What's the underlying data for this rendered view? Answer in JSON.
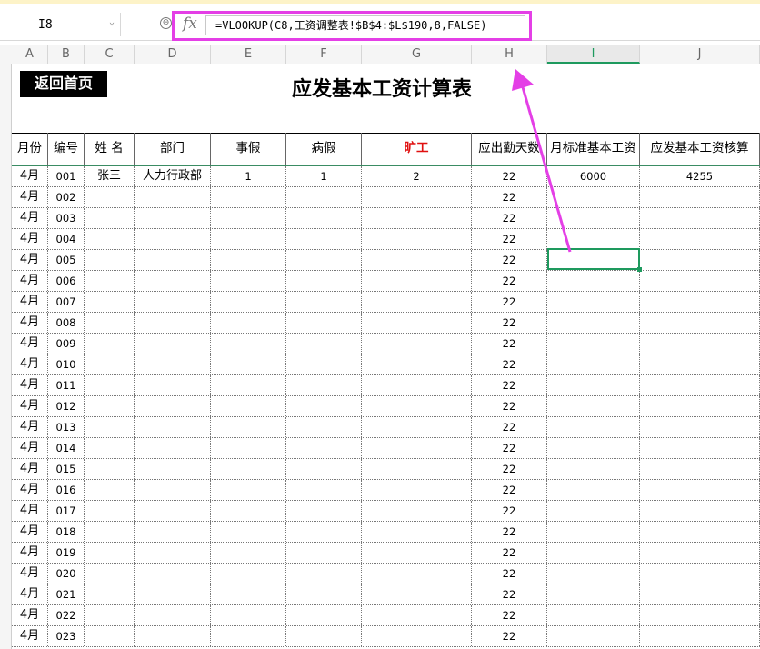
{
  "formula_bar": {
    "cell_ref": "I8",
    "fx_label": "fx",
    "formula": "=VLOOKUP(C8,工资调整表!$B$4:$L$190,8,FALSE)"
  },
  "columns": [
    "A",
    "B",
    "C",
    "D",
    "E",
    "F",
    "G",
    "H",
    "I",
    "J"
  ],
  "active_column": "I",
  "row_numbers": [
    "",
    "",
    "",
    "",
    "",
    "",
    "",
    "",
    "",
    "",
    "",
    "",
    "",
    "",
    "",
    "",
    "",
    "",
    "",
    "",
    "",
    "",
    "",
    "",
    "",
    "",
    "",
    "",
    "",
    ""
  ],
  "sheet": {
    "back_button": "返回首页",
    "title": "应发基本工资计算表",
    "headers": [
      "月份",
      "编号",
      "姓 名",
      "部门",
      "事假",
      "病假",
      "旷工",
      "应出勤天数",
      "月标准基本工资",
      "应发基本工资核算"
    ],
    "rows": [
      {
        "month": "4月",
        "id": "001",
        "name": "张三",
        "dept": "人力行政部",
        "personal_leave": "1",
        "sick_leave": "1",
        "absent": "2",
        "required_days": "22",
        "std_salary": "6000",
        "calc_salary": "4255"
      },
      {
        "month": "4月",
        "id": "002",
        "name": "",
        "dept": "",
        "personal_leave": "",
        "sick_leave": "",
        "absent": "",
        "required_days": "22",
        "std_salary": "",
        "calc_salary": ""
      },
      {
        "month": "4月",
        "id": "003",
        "name": "",
        "dept": "",
        "personal_leave": "",
        "sick_leave": "",
        "absent": "",
        "required_days": "22",
        "std_salary": "",
        "calc_salary": ""
      },
      {
        "month": "4月",
        "id": "004",
        "name": "",
        "dept": "",
        "personal_leave": "",
        "sick_leave": "",
        "absent": "",
        "required_days": "22",
        "std_salary": "",
        "calc_salary": ""
      },
      {
        "month": "4月",
        "id": "005",
        "name": "",
        "dept": "",
        "personal_leave": "",
        "sick_leave": "",
        "absent": "",
        "required_days": "22",
        "std_salary": "",
        "calc_salary": ""
      },
      {
        "month": "4月",
        "id": "006",
        "name": "",
        "dept": "",
        "personal_leave": "",
        "sick_leave": "",
        "absent": "",
        "required_days": "22",
        "std_salary": "",
        "calc_salary": ""
      },
      {
        "month": "4月",
        "id": "007",
        "name": "",
        "dept": "",
        "personal_leave": "",
        "sick_leave": "",
        "absent": "",
        "required_days": "22",
        "std_salary": "",
        "calc_salary": ""
      },
      {
        "month": "4月",
        "id": "008",
        "name": "",
        "dept": "",
        "personal_leave": "",
        "sick_leave": "",
        "absent": "",
        "required_days": "22",
        "std_salary": "",
        "calc_salary": ""
      },
      {
        "month": "4月",
        "id": "009",
        "name": "",
        "dept": "",
        "personal_leave": "",
        "sick_leave": "",
        "absent": "",
        "required_days": "22",
        "std_salary": "",
        "calc_salary": ""
      },
      {
        "month": "4月",
        "id": "010",
        "name": "",
        "dept": "",
        "personal_leave": "",
        "sick_leave": "",
        "absent": "",
        "required_days": "22",
        "std_salary": "",
        "calc_salary": ""
      },
      {
        "month": "4月",
        "id": "011",
        "name": "",
        "dept": "",
        "personal_leave": "",
        "sick_leave": "",
        "absent": "",
        "required_days": "22",
        "std_salary": "",
        "calc_salary": ""
      },
      {
        "month": "4月",
        "id": "012",
        "name": "",
        "dept": "",
        "personal_leave": "",
        "sick_leave": "",
        "absent": "",
        "required_days": "22",
        "std_salary": "",
        "calc_salary": ""
      },
      {
        "month": "4月",
        "id": "013",
        "name": "",
        "dept": "",
        "personal_leave": "",
        "sick_leave": "",
        "absent": "",
        "required_days": "22",
        "std_salary": "",
        "calc_salary": ""
      },
      {
        "month": "4月",
        "id": "014",
        "name": "",
        "dept": "",
        "personal_leave": "",
        "sick_leave": "",
        "absent": "",
        "required_days": "22",
        "std_salary": "",
        "calc_salary": ""
      },
      {
        "month": "4月",
        "id": "015",
        "name": "",
        "dept": "",
        "personal_leave": "",
        "sick_leave": "",
        "absent": "",
        "required_days": "22",
        "std_salary": "",
        "calc_salary": ""
      },
      {
        "month": "4月",
        "id": "016",
        "name": "",
        "dept": "",
        "personal_leave": "",
        "sick_leave": "",
        "absent": "",
        "required_days": "22",
        "std_salary": "",
        "calc_salary": ""
      },
      {
        "month": "4月",
        "id": "017",
        "name": "",
        "dept": "",
        "personal_leave": "",
        "sick_leave": "",
        "absent": "",
        "required_days": "22",
        "std_salary": "",
        "calc_salary": ""
      },
      {
        "month": "4月",
        "id": "018",
        "name": "",
        "dept": "",
        "personal_leave": "",
        "sick_leave": "",
        "absent": "",
        "required_days": "22",
        "std_salary": "",
        "calc_salary": ""
      },
      {
        "month": "4月",
        "id": "019",
        "name": "",
        "dept": "",
        "personal_leave": "",
        "sick_leave": "",
        "absent": "",
        "required_days": "22",
        "std_salary": "",
        "calc_salary": ""
      },
      {
        "month": "4月",
        "id": "020",
        "name": "",
        "dept": "",
        "personal_leave": "",
        "sick_leave": "",
        "absent": "",
        "required_days": "22",
        "std_salary": "",
        "calc_salary": ""
      },
      {
        "month": "4月",
        "id": "021",
        "name": "",
        "dept": "",
        "personal_leave": "",
        "sick_leave": "",
        "absent": "",
        "required_days": "22",
        "std_salary": "",
        "calc_salary": ""
      },
      {
        "month": "4月",
        "id": "022",
        "name": "",
        "dept": "",
        "personal_leave": "",
        "sick_leave": "",
        "absent": "",
        "required_days": "22",
        "std_salary": "",
        "calc_salary": ""
      },
      {
        "month": "4月",
        "id": "023",
        "name": "",
        "dept": "",
        "personal_leave": "",
        "sick_leave": "",
        "absent": "",
        "required_days": "22",
        "std_salary": "",
        "calc_salary": ""
      }
    ]
  },
  "colors": {
    "accent": "#1e9a5e",
    "highlight": "#e43fe6",
    "absent_header": "#e01010"
  }
}
